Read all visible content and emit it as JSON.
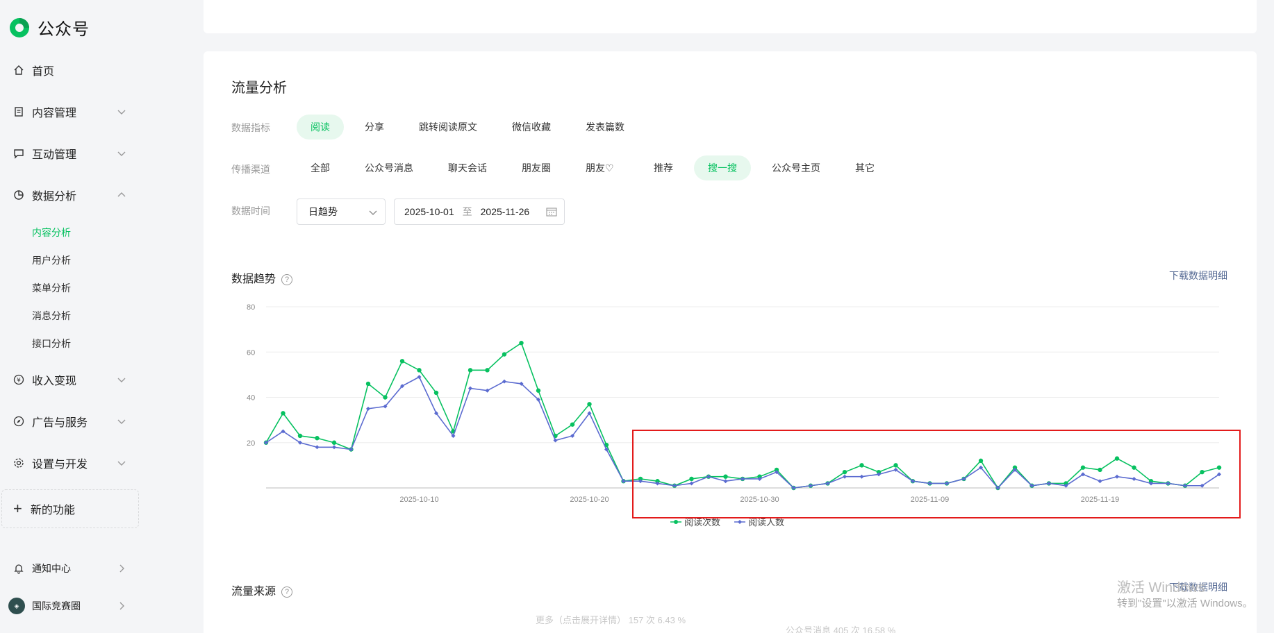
{
  "app": {
    "name": "公众号"
  },
  "sidebar": {
    "home": "首页",
    "content_mgmt": "内容管理",
    "interaction_mgmt": "互动管理",
    "data_analysis": "数据分析",
    "data_sub": [
      "内容分析",
      "用户分析",
      "菜单分析",
      "消息分析",
      "接口分析"
    ],
    "monetize": "收入变现",
    "ads": "广告与服务",
    "settings": "设置与开发",
    "new_feature": "新的功能",
    "notifications": "通知中心",
    "account": "国际竞赛圈"
  },
  "traffic": {
    "title": "流量分析",
    "metric_label": "数据指标",
    "metrics": [
      "阅读",
      "分享",
      "跳转阅读原文",
      "微信收藏",
      "发表篇数"
    ],
    "channel_label": "传播渠道",
    "channels": [
      "全部",
      "公众号消息",
      "聊天会话",
      "朋友圈",
      "朋友♡",
      "推荐",
      "搜一搜",
      "公众号主页",
      "其它"
    ],
    "time_label": "数据时间",
    "granularity": "日趋势",
    "date_from": "2025-10-01",
    "date_sep": "至",
    "date_to": "2025-11-26"
  },
  "trend": {
    "title": "数据趋势",
    "help": "?",
    "download": "下载数据明细"
  },
  "source": {
    "title": "流量来源",
    "help": "?",
    "download": "下载数据明细",
    "faded_left": "更多（点击展开详情） 157 次 6.43 %",
    "faded_right": "公众号消息 405 次 16.58 %"
  },
  "watermark": {
    "line1": "激活 Windows",
    "line2": "转到\"设置\"以激活 Windows。"
  },
  "chart_data": {
    "type": "line",
    "x_start": "2025-10-01",
    "x": [
      "2025-10-01",
      "2025-10-02",
      "2025-10-03",
      "2025-10-04",
      "2025-10-05",
      "2025-10-06",
      "2025-10-07",
      "2025-10-08",
      "2025-10-09",
      "2025-10-10",
      "2025-10-11",
      "2025-10-12",
      "2025-10-13",
      "2025-10-14",
      "2025-10-15",
      "2025-10-16",
      "2025-10-17",
      "2025-10-18",
      "2025-10-19",
      "2025-10-20",
      "2025-10-21",
      "2025-10-22",
      "2025-10-23",
      "2025-10-24",
      "2025-10-25",
      "2025-10-26",
      "2025-10-27",
      "2025-10-28",
      "2025-10-29",
      "2025-10-30",
      "2025-10-31",
      "2025-11-01",
      "2025-11-02",
      "2025-11-03",
      "2025-11-04",
      "2025-11-05",
      "2025-11-06",
      "2025-11-07",
      "2025-11-08",
      "2025-11-09",
      "2025-11-10",
      "2025-11-11",
      "2025-11-12",
      "2025-11-13",
      "2025-11-14",
      "2025-11-15",
      "2025-11-16",
      "2025-11-17",
      "2025-11-18",
      "2025-11-19",
      "2025-11-20",
      "2025-11-21",
      "2025-11-22",
      "2025-11-23",
      "2025-11-24",
      "2025-11-25",
      "2025-11-26"
    ],
    "x_ticks": [
      "2025-10-10",
      "2025-10-20",
      "2025-10-30",
      "2025-11-09",
      "2025-11-19"
    ],
    "ylim": [
      0,
      80
    ],
    "y_ticks": [
      20,
      40,
      60,
      80
    ],
    "series": [
      {
        "name": "阅读次数",
        "color": "#07c160",
        "values": [
          20,
          33,
          23,
          22,
          20,
          17,
          46,
          40,
          56,
          52,
          42,
          25,
          52,
          52,
          59,
          64,
          43,
          23,
          28,
          37,
          19,
          3,
          4,
          3,
          1,
          4,
          5,
          5,
          4,
          5,
          8,
          0,
          1,
          2,
          7,
          10,
          7,
          10,
          3,
          2,
          2,
          4,
          12,
          0,
          9,
          1,
          2,
          2,
          9,
          8,
          13,
          9,
          3,
          2,
          1,
          7,
          9
        ]
      },
      {
        "name": "阅读人数",
        "color": "#5b6bd0",
        "values": [
          20,
          25,
          20,
          18,
          18,
          17,
          35,
          36,
          45,
          49,
          33,
          23,
          44,
          43,
          47,
          46,
          39,
          21,
          23,
          33,
          17,
          3,
          3,
          2,
          1,
          2,
          5,
          3,
          4,
          4,
          7,
          0,
          1,
          2,
          5,
          5,
          6,
          8,
          3,
          2,
          2,
          4,
          9,
          0,
          8,
          1,
          2,
          1,
          6,
          3,
          5,
          4,
          2,
          2,
          1,
          1,
          6
        ]
      }
    ],
    "legend_position": "bottom-center",
    "grid": true
  }
}
